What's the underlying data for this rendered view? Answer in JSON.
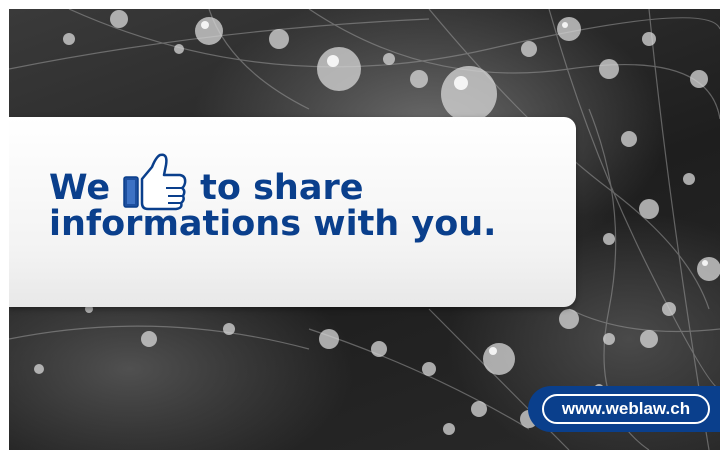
{
  "banner": {
    "text_part1": "We",
    "icon": "thumbs-up-like-icon",
    "text_part2": "to share",
    "text_line2": "informations with you.",
    "url": "www.weblaw.ch",
    "colors": {
      "text": "#0a3f8c",
      "badge": "#0a3f8c",
      "card": "#f3f3f3"
    }
  }
}
